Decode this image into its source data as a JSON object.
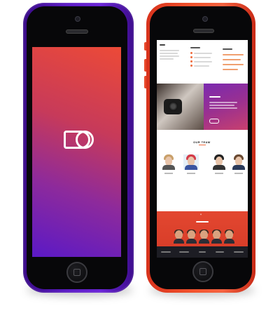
{
  "launch_screen": {
    "logo": "DO"
  },
  "site_preview": {
    "team_heading": "OUR TEAM",
    "quote_mark": "“",
    "colors": {
      "accent": "#ef6b3d",
      "gradient_start": "#ec4a37",
      "gradient_end": "#5b19c6",
      "purple_phone": "#5b1bc4",
      "red_phone": "#f3552f"
    }
  }
}
